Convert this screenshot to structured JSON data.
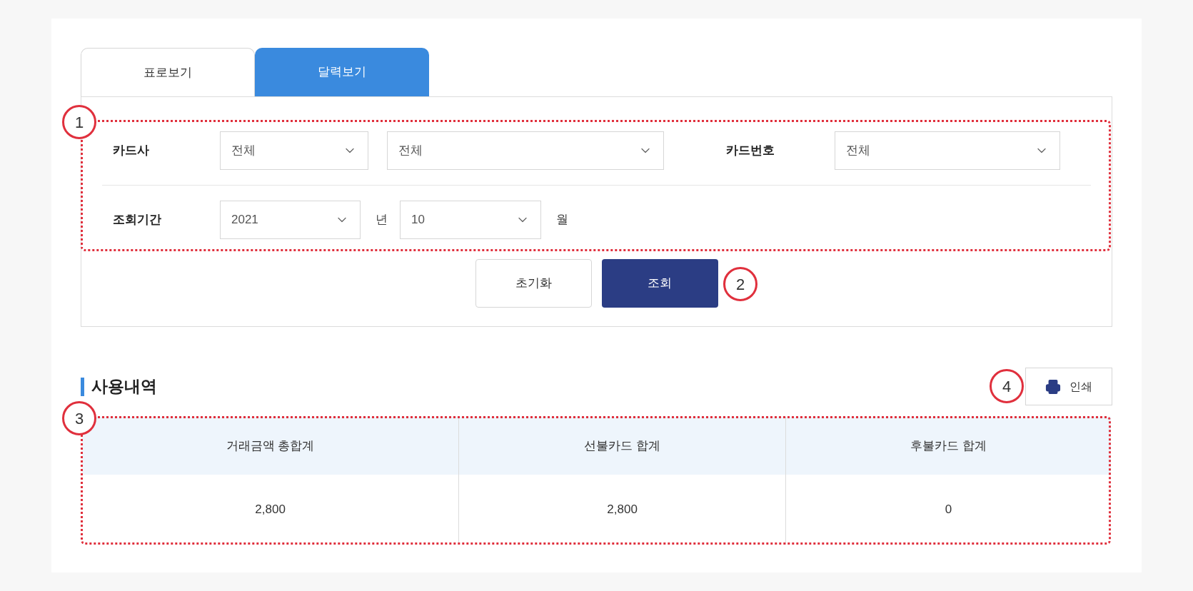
{
  "tabs": [
    {
      "label": "표로보기",
      "selected": false
    },
    {
      "label": "달력보기",
      "selected": true
    }
  ],
  "filters": [
    {
      "items": [
        {
          "kind": "label",
          "text": "카드사"
        },
        {
          "kind": "select",
          "value": "전체"
        },
        {
          "kind": "select",
          "value": "전체"
        },
        {
          "kind": "label",
          "text": "카드번호"
        },
        {
          "kind": "select",
          "value": "전체"
        }
      ]
    },
    {
      "items": [
        {
          "kind": "label",
          "text": "조회기간"
        },
        {
          "kind": "select",
          "value": "2021"
        },
        {
          "kind": "unit",
          "text": "년"
        },
        {
          "kind": "select",
          "value": "10"
        },
        {
          "kind": "unit",
          "text": "월"
        }
      ]
    }
  ],
  "buttons": [
    {
      "label": "초기화",
      "kind": "secondary"
    },
    {
      "label": "조회",
      "kind": "primary"
    }
  ],
  "section": {
    "title": "사용내역",
    "print_button": "인쇄"
  },
  "table": {
    "columns": [
      "거래금액 총합계",
      "선불카드 합계",
      "후불카드 합계"
    ],
    "rows": [
      [
        "2,800",
        "2,800",
        "0"
      ]
    ]
  },
  "annotations": [
    {
      "number": "1",
      "kind": "region"
    },
    {
      "number": "2",
      "kind": "marker"
    },
    {
      "number": "3",
      "kind": "region"
    },
    {
      "number": "4",
      "kind": "marker"
    }
  ]
}
